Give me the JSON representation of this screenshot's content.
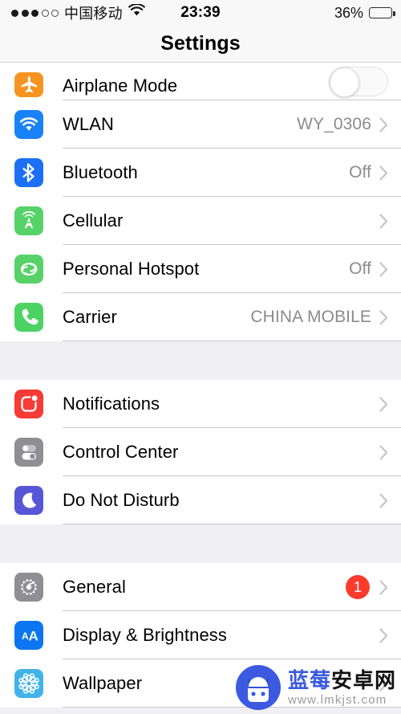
{
  "status_bar": {
    "signal_dots_filled": 3,
    "signal_dots_empty": 2,
    "carrier": "中国移动",
    "wifi_icon": "wifi-icon",
    "time": "23:39",
    "battery_percent": "36%",
    "battery_level": 36
  },
  "nav": {
    "title": "Settings"
  },
  "groups": [
    {
      "id": "connectivity",
      "rows": [
        {
          "label": "Airplane Mode",
          "icon": "airplane-icon",
          "icon_color": "#f79421",
          "accessory": "toggle",
          "toggle_on": false,
          "clipped": true
        },
        {
          "label": "WLAN",
          "icon": "wifi-icon",
          "icon_color": "#1a82f7",
          "detail": "WY_0306",
          "accessory": "chevron"
        },
        {
          "label": "Bluetooth",
          "icon": "bluetooth-icon",
          "icon_color": "#1d70f5",
          "detail": "Off",
          "accessory": "chevron"
        },
        {
          "label": "Cellular",
          "icon": "cell-tower-icon",
          "icon_color": "#57d268",
          "detail": "",
          "accessory": "chevron"
        },
        {
          "label": "Personal Hotspot",
          "icon": "hotspot-link-icon",
          "icon_color": "#57d268",
          "detail": "Off",
          "accessory": "chevron"
        },
        {
          "label": "Carrier",
          "icon": "phone-icon",
          "icon_color": "#4cd364",
          "detail": "CHINA MOBILE",
          "accessory": "chevron"
        }
      ]
    },
    {
      "id": "alerts",
      "rows": [
        {
          "label": "Notifications",
          "icon": "notifications-icon",
          "icon_color": "#f83b35",
          "accessory": "chevron"
        },
        {
          "label": "Control Center",
          "icon": "control-center-icon",
          "icon_color": "#8e8e93",
          "accessory": "chevron"
        },
        {
          "label": "Do Not Disturb",
          "icon": "moon-icon",
          "icon_color": "#5756d6",
          "accessory": "chevron"
        }
      ]
    },
    {
      "id": "system",
      "rows": [
        {
          "label": "General",
          "icon": "gear-icon",
          "icon_color": "#8e8e93",
          "badge": "1",
          "badge_color": "#fc3b2d",
          "accessory": "chevron"
        },
        {
          "label": "Display & Brightness",
          "icon": "display-aa-icon",
          "icon_color": "#0b76ef",
          "accessory": "chevron"
        },
        {
          "label": "Wallpaper",
          "icon": "wallpaper-flower-icon",
          "icon_color": "#41b3e8",
          "accessory": "chevron"
        }
      ]
    }
  ],
  "watermark": {
    "logo": "blueberry-android-mascot-icon",
    "title_blue": "蓝莓",
    "title_black": "安卓网",
    "url": "www.lmkjst.com",
    "blue": "#3b5ae0"
  }
}
